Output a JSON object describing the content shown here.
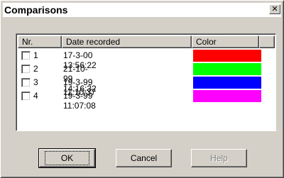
{
  "window": {
    "title": "Comparisons",
    "close_label": "✕"
  },
  "columns": [
    "Nr.",
    "Date recorded",
    "Color"
  ],
  "rows": [
    {
      "nr": "1",
      "date": "17-3-00 13:56:22",
      "color": "#ff0000",
      "checked": false
    },
    {
      "nr": "2",
      "date": "21-10-99 14:16:32",
      "color": "#00ff00",
      "checked": false
    },
    {
      "nr": "3",
      "date": "19-3-99 11:10:37",
      "color": "#0000ff",
      "checked": false
    },
    {
      "nr": "4",
      "date": "19-3-99 11:07:08",
      "color": "#ff00ff",
      "checked": false
    }
  ],
  "buttons": {
    "ok": "OK",
    "cancel": "Cancel",
    "help": "Help"
  }
}
